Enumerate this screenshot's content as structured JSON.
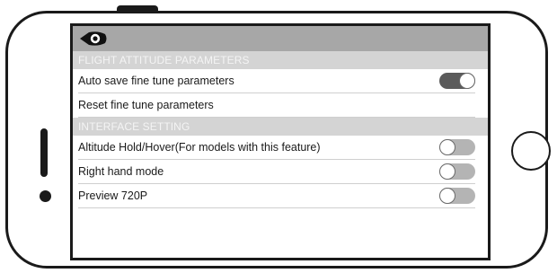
{
  "toolbar": {
    "back_icon": "back-arrow-eye-icon"
  },
  "sections": [
    {
      "header": "FLIGHT ATTITUDE PARAMETERS",
      "items": [
        {
          "label": "Auto save fine tune parameters",
          "has_toggle": true,
          "on": true
        },
        {
          "label": "Reset fine tune parameters",
          "has_toggle": false
        }
      ]
    },
    {
      "header": "INTERFACE SETTING",
      "items": [
        {
          "label": "Altitude Hold/Hover(For models with this feature)",
          "has_toggle": true,
          "on": false
        },
        {
          "label": "Right hand mode",
          "has_toggle": true,
          "on": false
        },
        {
          "label": "Preview 720P",
          "has_toggle": true,
          "on": false
        }
      ]
    }
  ],
  "colors": {
    "topbar": "#a7a7a7",
    "section_header_bg": "#d4d4d4",
    "toggle_on": "#5b5b5b",
    "toggle_off": "#b4b4b4"
  }
}
